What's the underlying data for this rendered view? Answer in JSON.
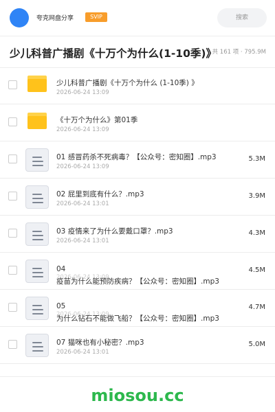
{
  "header": {
    "username": "夸克网盘分享",
    "badge": "SVIP",
    "search_placeholder": "搜索"
  },
  "folder": {
    "title": "少儿科普广播剧《十万个为什么(1-10季)》",
    "count": "共 161 项 · 795.9M"
  },
  "items": [
    {
      "type": "folder",
      "name": "少儿科普广播剧《十万个为什么 (1-10季) 》",
      "date": "2026-06-24 13:09",
      "size": ""
    },
    {
      "type": "folder",
      "name": "《十万个为什么》第01季",
      "date": "2026-06-24 13:09",
      "size": ""
    },
    {
      "type": "file",
      "name": "01 感冒药杀不死病毒？【公众号：密知圈】.mp3",
      "date": "2026-06-24 13:09",
      "size": "5.3M"
    },
    {
      "type": "file",
      "name": "02 屁里到底有什么？.mp3",
      "date": "2026-06-24 13:01",
      "size": "3.9M"
    },
    {
      "type": "file",
      "name": "03 疫情来了为什么要戴口罩？.mp3",
      "date": "2026-06-24 13:01",
      "size": "4.3M"
    },
    {
      "type": "file",
      "name_line1": "04",
      "name_line2": "疫苗为什么能预防疾病？【公众号：密知圈】.mp3",
      "date": "2026-06-24 13:09",
      "size": "4.5M"
    },
    {
      "type": "file",
      "name_line1": "05",
      "name_line2": "为什么钻石不能做飞船？【公众号：密知圈】.mp3",
      "date": "2026-06-24 13:09",
      "size": "4.7M"
    },
    {
      "type": "file",
      "name": "07 猫咪也有小秘密？.mp3",
      "date": "2026-06-24 13:01",
      "size": "5.0M"
    }
  ],
  "watermark": "miosou.cc",
  "colors": {
    "accent": "#2f84f6",
    "badge": "#f89d2b",
    "folder": "#ffc21b",
    "watermark": "#2db84d"
  }
}
